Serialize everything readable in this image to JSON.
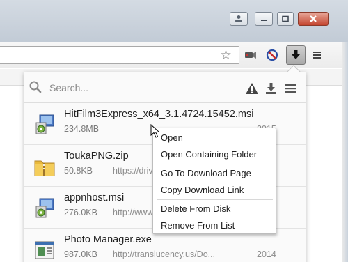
{
  "window": {
    "controls": [
      "profile-icon",
      "minimize-icon",
      "maximize-icon",
      "close-icon"
    ]
  },
  "toolbar": {
    "icons": [
      "star-icon",
      "camera-extension-icon",
      "block-extension-icon",
      "download-arrow-icon",
      "menu-icon"
    ]
  },
  "panel": {
    "search_placeholder": "Search...",
    "items": [
      {
        "name": "HitFilm3Express_x64_3.1.4724.15452.msi",
        "size": "234.8MB",
        "url": "",
        "year": "2015",
        "icon": "msi-installer-icon"
      },
      {
        "name": "ToukaPNG.zip",
        "size": "50.8KB",
        "url": "https://driv",
        "year": "",
        "icon": "zip-folder-icon"
      },
      {
        "name": "appnhost.msi",
        "size": "276.0KB",
        "url": "http://www",
        "year": "",
        "icon": "msi-installer-icon"
      },
      {
        "name": "Photo Manager.exe",
        "size": "987.0KB",
        "url": "http://translucency.us/Do...",
        "year": "2014",
        "icon": "exe-app-icon"
      }
    ]
  },
  "context_menu": {
    "items": [
      "Open",
      "Open Containing Folder",
      "Go To Download Page",
      "Copy Download Link",
      "Delete From Disk",
      "Remove From List"
    ]
  }
}
